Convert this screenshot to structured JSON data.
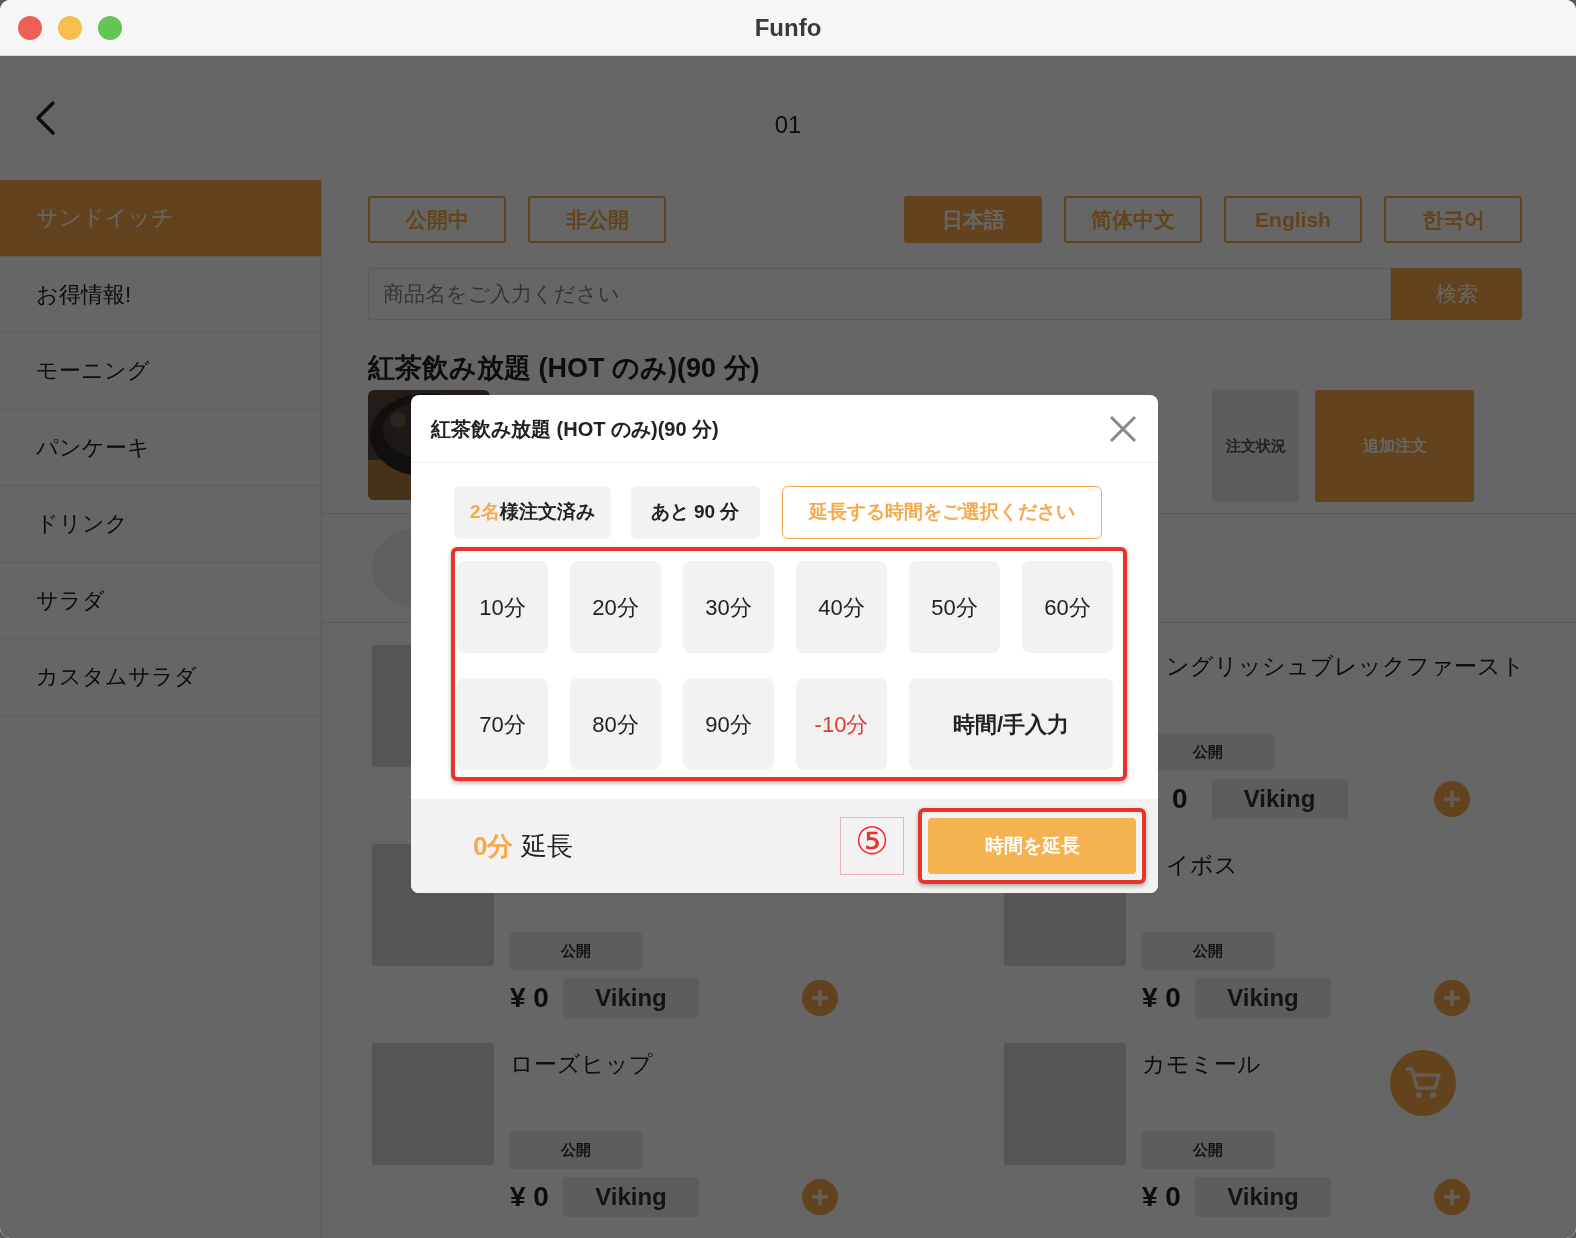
{
  "window": {
    "title": "Funfo"
  },
  "header": {
    "table": "01"
  },
  "sidebar": {
    "items": [
      {
        "label": "サンドイッチ",
        "selected": true
      },
      {
        "label": "お得情報!",
        "selected": false
      },
      {
        "label": "モーニング",
        "selected": false
      },
      {
        "label": "パンケーキ",
        "selected": false
      },
      {
        "label": "ドリンク",
        "selected": false
      },
      {
        "label": "サラダ",
        "selected": false
      },
      {
        "label": "カスタムサラダ",
        "selected": false
      }
    ]
  },
  "filters": [
    {
      "label": "公開中",
      "selected": false
    },
    {
      "label": "非公開",
      "selected": false
    }
  ],
  "languages": [
    {
      "label": "日本語",
      "selected": true
    },
    {
      "label": "简体中文",
      "selected": false
    },
    {
      "label": "English",
      "selected": false
    },
    {
      "label": "한국어",
      "selected": false
    }
  ],
  "search": {
    "placeholder": "商品名をご入力ください",
    "button": "検索"
  },
  "product": {
    "title": "紅茶飲み放題 (HOT のみ)(90 分)",
    "status_button": "注文状況",
    "order_button": "追加注文"
  },
  "items": [
    {
      "name": "ングリッシュブレックファースト",
      "badge": "公開",
      "price": "0",
      "tag": "Viking"
    },
    {
      "badge": "公開",
      "price": "¥ 0",
      "tag": "Viking"
    },
    {
      "name": "イボス",
      "badge": "公開",
      "price": "¥ 0",
      "tag": "Viking"
    },
    {
      "name": "ローズヒップ",
      "badge": "公開",
      "price": "¥ 0",
      "tag": "Viking"
    },
    {
      "name": "カモミール",
      "badge": "公開",
      "price": "¥ 0",
      "tag": "Viking"
    }
  ],
  "modal": {
    "title": "紅茶飲み放題 (HOT のみ)(90 分)",
    "ordered_count": "2名",
    "ordered_suffix": "様注文済み",
    "remaining": "あと 90 分",
    "prompt": "延長する時間をご選択ください",
    "options": [
      {
        "label": "10分",
        "kind": "add"
      },
      {
        "label": "20分",
        "kind": "add"
      },
      {
        "label": "30分",
        "kind": "add"
      },
      {
        "label": "40分",
        "kind": "add"
      },
      {
        "label": "50分",
        "kind": "add"
      },
      {
        "label": "60分",
        "kind": "add"
      },
      {
        "label": "70分",
        "kind": "add"
      },
      {
        "label": "80分",
        "kind": "add"
      },
      {
        "label": "90分",
        "kind": "add"
      },
      {
        "label": "-10分",
        "kind": "subtract"
      },
      {
        "label": "時間/手入力",
        "kind": "manual"
      }
    ],
    "extension_value": "0分",
    "extension_label": "延長",
    "annotation": "⑤",
    "submit": "時間を延長"
  }
}
